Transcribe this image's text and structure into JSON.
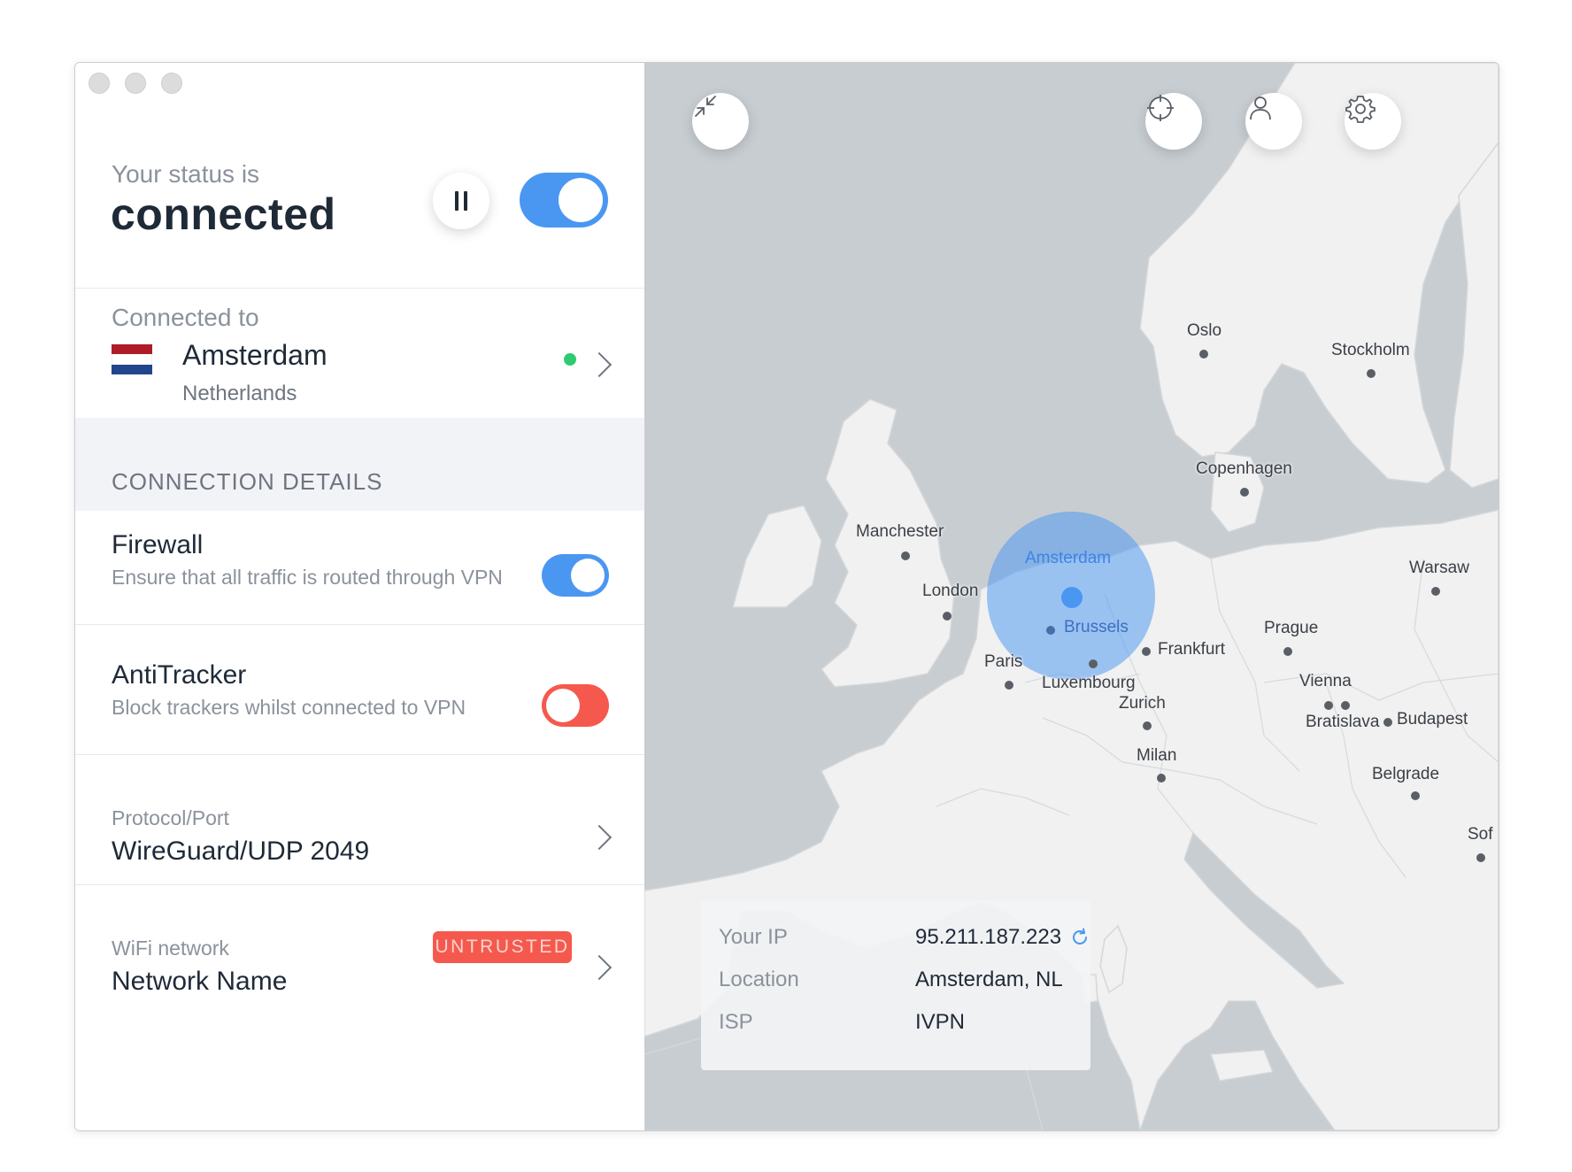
{
  "status": {
    "label": "Your status is",
    "value": "connected",
    "pause_icon": "pause-icon",
    "connected_toggle_on": true
  },
  "connection": {
    "label": "Connected to",
    "city": "Amsterdam",
    "country": "Netherlands",
    "flag_colors": [
      "#ae1c28",
      "#ffffff",
      "#21468b"
    ],
    "indicator_color": "#2ecc71"
  },
  "details": {
    "title": "CONNECTION DETAILS",
    "firewall": {
      "title": "Firewall",
      "description": "Ensure that all traffic is routed through VPN",
      "enabled": true
    },
    "antitracker": {
      "title": "AntiTracker",
      "description": "Block trackers whilst connected to VPN",
      "enabled": false
    },
    "protocol": {
      "label": "Protocol/Port",
      "value": "WireGuard/UDP 2049"
    },
    "wifi": {
      "label": "WiFi network",
      "value": "Network Name",
      "badge": "UNTRUSTED"
    }
  },
  "map": {
    "cities": {
      "oslo": "Oslo",
      "stockholm": "Stockholm",
      "copenhagen": "Copenhagen",
      "manchester": "Manchester",
      "amsterdam": "Amsterdam",
      "warsaw": "Warsaw",
      "london": "London",
      "brussels": "Brussels",
      "frankfurt": "Frankfurt",
      "prague": "Prague",
      "paris": "Paris",
      "luxembourg": "Luxembourg",
      "vienna": "Vienna",
      "zurich": "Zurich",
      "bratislava": "Bratislava",
      "budapest": "Budapest",
      "milan": "Milan",
      "belgrade": "Belgrade",
      "sofia": "Sof"
    },
    "buttons": [
      "minimize-icon",
      "crosshair-icon",
      "user-icon",
      "gear-icon"
    ]
  },
  "info": {
    "ip_label": "Your IP",
    "ip_value": "95.211.187.223",
    "location_label": "Location",
    "location_value": "Amsterdam, NL",
    "isp_label": "ISP",
    "isp_value": "IVPN"
  },
  "colors": {
    "accent": "#4a97f2",
    "danger": "#f5594d",
    "map_sea": "#c7cdd1",
    "map_land": "#f1f1f1"
  }
}
